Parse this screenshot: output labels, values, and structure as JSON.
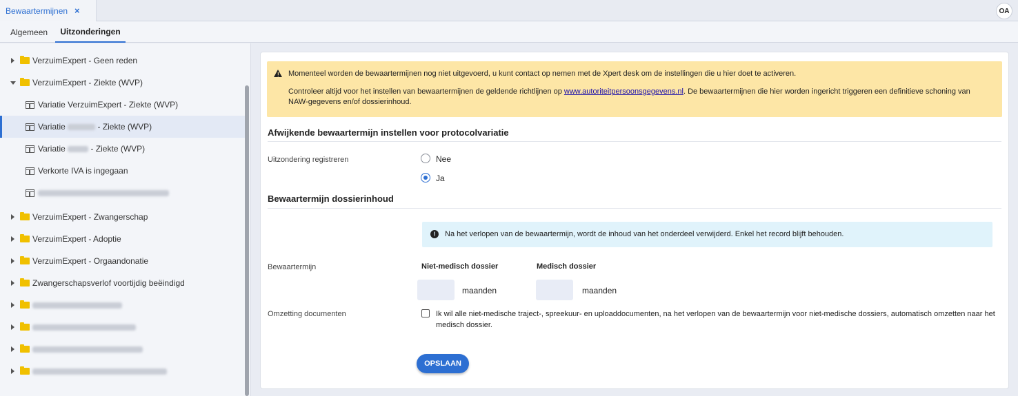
{
  "window": {
    "tab_title": "Bewaartermijnen",
    "tab_close": "×",
    "avatar": "OA"
  },
  "subtabs": [
    {
      "label": "Algemeen",
      "active": false
    },
    {
      "label": "Uitzonderingen",
      "active": true
    }
  ],
  "tree": {
    "items": [
      {
        "label": "VerzuimExpert - Geen reden",
        "type": "folder",
        "expanded": false
      },
      {
        "label": "VerzuimExpert - Ziekte (WVP)",
        "type": "folder",
        "expanded": true
      },
      {
        "label": "Variatie VerzuimExpert - Ziekte (WVP)",
        "type": "table"
      },
      {
        "label_prefix": "Variatie",
        "label_suffix": "- Ziekte (WVP)",
        "type": "table",
        "selected": true
      },
      {
        "label_prefix": "Variatie",
        "label_suffix": "- Ziekte (WVP)",
        "type": "table"
      },
      {
        "label": "Verkorte IVA is ingegaan",
        "type": "table"
      },
      {
        "label": "",
        "type": "table"
      },
      {
        "label": "VerzuimExpert - Zwangerschap",
        "type": "folder"
      },
      {
        "label": "VerzuimExpert - Adoptie",
        "type": "folder"
      },
      {
        "label": "VerzuimExpert - Orgaandonatie",
        "type": "folder"
      },
      {
        "label": "Zwangerschapsverlof voortijdig beëindigd",
        "type": "folder"
      },
      {
        "label": "",
        "type": "folder"
      },
      {
        "label": "",
        "type": "folder"
      },
      {
        "label": "",
        "type": "folder"
      },
      {
        "label": "",
        "type": "folder"
      }
    ]
  },
  "warning": {
    "line1": "Momenteel worden de bewaartermijnen nog niet uitgevoerd, u kunt contact op nemen met de Xpert desk om de instellingen die u hier doet te activeren.",
    "line2_before": "Controleer altijd voor het instellen van bewaartermijnen de geldende richtlijnen op ",
    "link": "www.autoriteitpersoonsgegevens.nl",
    "line2_after": ". De bewaartermijnen die hier worden ingericht triggeren een definitieve schoning van NAW-gegevens en/of dossierinhoud."
  },
  "section1": {
    "title": "Afwijkende bewaartermijn instellen voor protocolvariatie",
    "field_label": "Uitzondering registreren",
    "options": [
      {
        "label": "Nee",
        "selected": false
      },
      {
        "label": "Ja",
        "selected": true
      }
    ]
  },
  "section2": {
    "title": "Bewaartermijn dossierinhoud",
    "info": "Na het verlopen van de bewaartermijn, wordt de inhoud van het onderdeel verwijderd. Enkel het record blijft behouden.",
    "term_label": "Bewaartermijn",
    "col_non_medical": "Niet-medisch dossier",
    "col_medical": "Medisch dossier",
    "non_medical_value": "",
    "medical_value": "",
    "unit": "maanden",
    "conversion_label": "Omzetting documenten",
    "conversion_text": "Ik wil alle niet-medische traject-, spreekuur- en uploaddocumenten, na het verlopen van de bewaartermijn voor niet-medische dossiers, automatisch omzetten naar het medisch dossier.",
    "conversion_checked": false
  },
  "actions": {
    "save": "OPSLAAN"
  },
  "colors": {
    "accent": "#2d6fd2",
    "warning_bg": "#fde6a6",
    "info_bg": "#e0f3fb",
    "folder": "#f0c000"
  }
}
